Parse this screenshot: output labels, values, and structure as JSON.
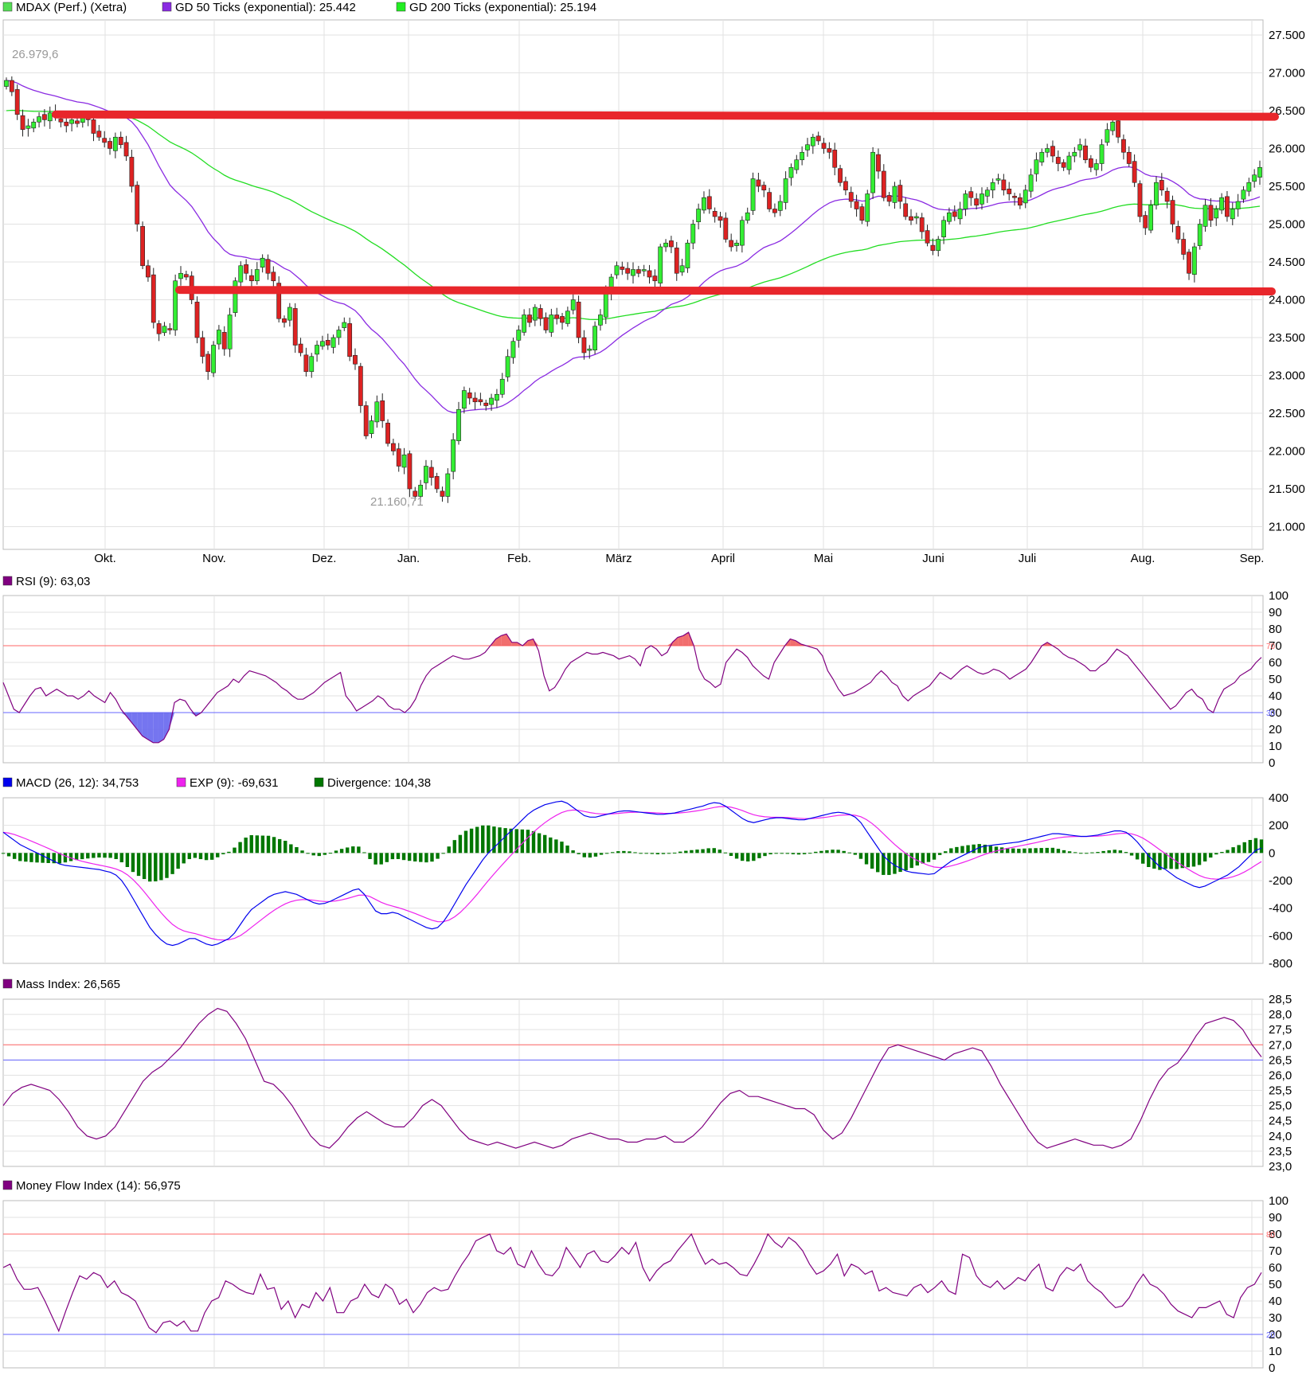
{
  "chart_data": [
    {
      "type": "candlestick",
      "legend": [
        {
          "label": "MDAX (Perf.) (Xetra)",
          "color": "#55dd55"
        },
        {
          "label": "GD 50 Ticks (exponential): 25.442",
          "color": "#8a2be2"
        },
        {
          "label": "GD 200 Ticks (exponential): 25.194",
          "color": "#22ee22"
        }
      ],
      "x_ticks": [
        "Okt.",
        "Nov.",
        "Dez.",
        "Jan.",
        "Feb.",
        "März",
        "April",
        "Mai",
        "Juni",
        "Juli",
        "Aug.",
        "Sep."
      ],
      "y_ticks": [
        "21.000",
        "21.500",
        "22.000",
        "22.500",
        "23.000",
        "23.500",
        "24.000",
        "24.500",
        "25.000",
        "25.500",
        "26.000",
        "26.500",
        "27.000",
        "27.500"
      ],
      "ylim": [
        20700,
        27700
      ],
      "annotations": {
        "high": "26.979,6",
        "low": "21.160,71"
      },
      "closes": [
        26900,
        26750,
        26450,
        26250,
        26300,
        26350,
        26420,
        26380,
        26470,
        26420,
        26350,
        26300,
        26380,
        26330,
        26450,
        26380,
        26200,
        26150,
        26080,
        26000,
        26150,
        26050,
        25900,
        25500,
        25000,
        24450,
        24300,
        23700,
        23550,
        23650,
        23600,
        24250,
        24350,
        24300,
        24000,
        23500,
        23250,
        23050,
        23400,
        23600,
        23350,
        23800,
        24250,
        24450,
        24350,
        24250,
        24400,
        24550,
        24350,
        24250,
        23750,
        23700,
        23900,
        23400,
        23300,
        23050,
        23250,
        23400,
        23450,
        23400,
        23500,
        23600,
        23700,
        23250,
        23150,
        22600,
        22200,
        22400,
        22650,
        22400,
        22100,
        22000,
        21800,
        21950,
        21500,
        21400,
        21550,
        21800,
        21650,
        21500,
        21400,
        21700,
        22150,
        22550,
        22800,
        22700,
        22650,
        22650,
        22600,
        22700,
        22750,
        22950,
        23250,
        23450,
        23600,
        23800,
        23700,
        23900,
        23750,
        23600,
        23800,
        23750,
        23700,
        23850,
        24000,
        23500,
        23300,
        23350,
        23650,
        23800,
        24100,
        24300,
        24450,
        24400,
        24350,
        24400,
        24350,
        24400,
        24300,
        24250,
        24700,
        24750,
        24700,
        24350,
        24450,
        24750,
        25000,
        25200,
        25350,
        25200,
        25100,
        25050,
        24800,
        24700,
        24750,
        25050,
        25150,
        25600,
        25500,
        25450,
        25200,
        25150,
        25300,
        25600,
        25750,
        25850,
        25950,
        26050,
        26150,
        26100,
        26000,
        25950,
        25750,
        25550,
        25450,
        25300,
        25200,
        25050,
        25400,
        25950,
        25700,
        25350,
        25300,
        25500,
        25300,
        25100,
        25050,
        25100,
        24900,
        24750,
        24650,
        24800,
        25050,
        25150,
        25100,
        25200,
        25400,
        25350,
        25250,
        25400,
        25450,
        25550,
        25600,
        25450,
        25400,
        25350,
        25250,
        25450,
        25650,
        25850,
        25950,
        26000,
        25900,
        25800,
        25750,
        25900,
        25950,
        26050,
        25850,
        25750,
        25800,
        26050,
        26250,
        26350,
        26150,
        25950,
        25800,
        25550,
        25100,
        24950,
        25250,
        25550,
        25450,
        25300,
        25000,
        24800,
        24600,
        24350,
        24700,
        25000,
        25250,
        25050,
        25200,
        25350,
        25100,
        25200,
        25300,
        25450,
        25550,
        25650,
        25750
      ]
    },
    {
      "type": "line",
      "title": "RSI (9): 63,03",
      "color": "#800080",
      "ylim": [
        0,
        100
      ],
      "y_ticks": [
        "0",
        "10",
        "20",
        "30",
        "40",
        "50",
        "60",
        "70",
        "80",
        "90",
        "100"
      ],
      "ref_lines": [
        {
          "value": 70,
          "label": "70",
          "color": "#ff6666"
        },
        {
          "value": 30,
          "label": "30",
          "color": "#6666ff"
        }
      ],
      "values": [
        48,
        40,
        32,
        30,
        35,
        40,
        44,
        45,
        40,
        42,
        44,
        42,
        40,
        40,
        38,
        40,
        43,
        40,
        38,
        36,
        42,
        38,
        32,
        28,
        24,
        20,
        16,
        14,
        12,
        12,
        14,
        20,
        36,
        38,
        37,
        32,
        28,
        30,
        34,
        38,
        42,
        44,
        46,
        50,
        48,
        52,
        55,
        54,
        53,
        52,
        50,
        48,
        45,
        43,
        40,
        38,
        38,
        40,
        42,
        45,
        48,
        50,
        52,
        54,
        40,
        36,
        31,
        33,
        35,
        37,
        40,
        38,
        34,
        32,
        32,
        30,
        33,
        38,
        46,
        52,
        56,
        58,
        60,
        62,
        64,
        63,
        62,
        62,
        63,
        64,
        66,
        70,
        74,
        76,
        77,
        72,
        72,
        70,
        73,
        74,
        67,
        52,
        43,
        45,
        50,
        56,
        60,
        62,
        64,
        66,
        65,
        65,
        66,
        65,
        64,
        62,
        63,
        64,
        62,
        58,
        68,
        70,
        68,
        64,
        66,
        72,
        75,
        76,
        78,
        70,
        56,
        50,
        48,
        45,
        47,
        60,
        64,
        68,
        66,
        63,
        58,
        55,
        52,
        50,
        60,
        65,
        70,
        74,
        73,
        71,
        70,
        69,
        68,
        64,
        55,
        50,
        44,
        40,
        41,
        42,
        44,
        46,
        48,
        52,
        55,
        52,
        48,
        46,
        40,
        37,
        40,
        42,
        44,
        46,
        50,
        54,
        52,
        50,
        53,
        56,
        58,
        56,
        54,
        53,
        54,
        56,
        55,
        53,
        50,
        52,
        54,
        56,
        60,
        65,
        70,
        72,
        70,
        68,
        65,
        63,
        62,
        60,
        58,
        55,
        55,
        58,
        60,
        64,
        68,
        66,
        64,
        60,
        56,
        52,
        48,
        44,
        40,
        36,
        32,
        34,
        38,
        42,
        44,
        40,
        38,
        32,
        30,
        38,
        44,
        46,
        48,
        52,
        54,
        56,
        60,
        63
      ]
    },
    {
      "type": "line+bar",
      "legend": [
        {
          "label": "MACD (26, 12): 34,753",
          "color": "#0000ee"
        },
        {
          "label": "EXP (9): -69,631",
          "color": "#ee22ee"
        },
        {
          "label": "Divergence: 104,38",
          "color": "#007700"
        }
      ],
      "ylim": [
        -800,
        400
      ],
      "y_ticks": [
        "-800",
        "-600",
        "-400",
        "-200",
        "0",
        "200",
        "400"
      ],
      "macd": [
        150,
        120,
        90,
        60,
        40,
        20,
        0,
        -20,
        -40,
        -60,
        -80,
        -90,
        -95,
        -100,
        -105,
        -110,
        -115,
        -120,
        -130,
        -140,
        -160,
        -200,
        -260,
        -330,
        -400,
        -470,
        -540,
        -590,
        -630,
        -660,
        -670,
        -660,
        -640,
        -620,
        -620,
        -640,
        -660,
        -670,
        -660,
        -640,
        -620,
        -580,
        -520,
        -460,
        -410,
        -380,
        -350,
        -320,
        -300,
        -290,
        -280,
        -290,
        -300,
        -320,
        -340,
        -360,
        -370,
        -365,
        -350,
        -330,
        -310,
        -290,
        -270,
        -260,
        -300,
        -360,
        -420,
        -440,
        -440,
        -430,
        -440,
        -460,
        -480,
        -500,
        -520,
        -540,
        -550,
        -540,
        -500,
        -440,
        -370,
        -300,
        -230,
        -170,
        -110,
        -50,
        0,
        40,
        80,
        120,
        160,
        200,
        240,
        280,
        310,
        330,
        350,
        360,
        370,
        375,
        360,
        330,
        300,
        270,
        260,
        260,
        270,
        280,
        290,
        300,
        305,
        305,
        300,
        295,
        290,
        285,
        280,
        280,
        285,
        290,
        300,
        310,
        320,
        330,
        340,
        355,
        365,
        360,
        340,
        310,
        280,
        250,
        230,
        220,
        230,
        240,
        250,
        255,
        255,
        250,
        245,
        240,
        240,
        250,
        260,
        270,
        280,
        290,
        295,
        290,
        280,
        260,
        220,
        160,
        100,
        40,
        -20,
        -60,
        -90,
        -110,
        -130,
        -140,
        -145,
        -150,
        -155,
        -150,
        -120,
        -90,
        -60,
        -40,
        -20,
        0,
        20,
        40,
        50,
        55,
        60,
        65,
        70,
        75,
        80,
        90,
        100,
        110,
        120,
        130,
        140,
        140,
        135,
        130,
        125,
        120,
        120,
        125,
        130,
        140,
        150,
        160,
        160,
        150,
        120,
        80,
        30,
        -20,
        -60,
        -100,
        -120,
        -150,
        -180,
        -200,
        -220,
        -240,
        -250,
        -240,
        -220,
        -200,
        -180,
        -160,
        -130,
        -100,
        -60,
        -20,
        20,
        35
      ]
    },
    {
      "type": "line",
      "title": "Mass Index: 26,565",
      "color": "#800080",
      "ylim": [
        23.0,
        28.5
      ],
      "y_ticks": [
        "23,0",
        "23,5",
        "24,0",
        "24,5",
        "25,0",
        "25,5",
        "26,0",
        "26,5",
        "27,0",
        "27,5",
        "28,0",
        "28,5"
      ],
      "ref_lines": [
        {
          "value": 27.0,
          "color": "#ff6666"
        },
        {
          "value": 26.5,
          "color": "#6666ff"
        }
      ],
      "values": [
        25.0,
        25.4,
        25.6,
        25.7,
        25.6,
        25.5,
        25.2,
        24.8,
        24.3,
        24.0,
        23.9,
        24.0,
        24.3,
        24.8,
        25.3,
        25.8,
        26.1,
        26.3,
        26.6,
        26.9,
        27.3,
        27.7,
        28.0,
        28.2,
        28.1,
        27.7,
        27.2,
        26.5,
        25.8,
        25.7,
        25.4,
        25.0,
        24.5,
        24.0,
        23.7,
        23.6,
        23.9,
        24.3,
        24.6,
        24.8,
        24.6,
        24.4,
        24.3,
        24.3,
        24.6,
        25.0,
        25.2,
        25.0,
        24.6,
        24.2,
        23.9,
        23.8,
        23.7,
        23.8,
        23.7,
        23.6,
        23.7,
        23.8,
        23.7,
        23.6,
        23.7,
        23.9,
        24.0,
        24.1,
        24.0,
        23.9,
        23.9,
        23.8,
        23.8,
        23.9,
        23.9,
        24.0,
        23.8,
        23.8,
        24.0,
        24.3,
        24.7,
        25.1,
        25.4,
        25.5,
        25.3,
        25.3,
        25.2,
        25.1,
        25.0,
        24.9,
        24.9,
        24.7,
        24.2,
        23.9,
        24.1,
        24.6,
        25.2,
        25.8,
        26.4,
        26.9,
        27.0,
        26.9,
        26.8,
        26.7,
        26.6,
        26.5,
        26.7,
        26.8,
        26.9,
        26.8,
        26.3,
        25.7,
        25.2,
        24.7,
        24.2,
        23.8,
        23.6,
        23.7,
        23.8,
        23.9,
        23.8,
        23.7,
        23.7,
        23.6,
        23.7,
        23.9,
        24.5,
        25.2,
        25.8,
        26.2,
        26.4,
        26.8,
        27.3,
        27.7,
        27.8,
        27.9,
        27.8,
        27.5,
        27.0,
        26.6
      ],
      "x_ticks": [
        "Okt.",
        "Nov.",
        "Dez.",
        "Jan.",
        "Feb.",
        "März",
        "April",
        "Mai",
        "Juni",
        "Juli",
        "Aug.",
        "Sep."
      ]
    },
    {
      "type": "line",
      "title": "Money Flow Index (14): 56,975",
      "color": "#800080",
      "ylim": [
        0,
        100
      ],
      "y_ticks": [
        "0",
        "10",
        "20",
        "30",
        "40",
        "50",
        "60",
        "70",
        "80",
        "90",
        "100"
      ],
      "ref_lines": [
        {
          "value": 80,
          "label": "80",
          "color": "#ff6666"
        },
        {
          "value": 20,
          "label": "20",
          "color": "#6666ff"
        }
      ],
      "values": [
        60,
        62,
        53,
        47,
        47,
        48,
        40,
        31,
        22,
        34,
        45,
        55,
        53,
        57,
        55,
        48,
        52,
        45,
        43,
        40,
        32,
        24,
        21,
        27,
        28,
        25,
        28,
        22,
        22,
        33,
        40,
        42,
        52,
        50,
        47,
        45,
        44,
        56,
        47,
        48,
        35,
        40,
        30,
        38,
        36,
        45,
        40,
        48,
        33,
        33,
        40,
        42,
        50,
        44,
        42,
        50,
        47,
        38,
        41,
        33,
        38,
        45,
        48,
        46,
        47,
        55,
        62,
        68,
        76,
        78,
        80,
        70,
        68,
        72,
        62,
        60,
        70,
        62,
        56,
        55,
        60,
        72,
        66,
        60,
        68,
        70,
        64,
        63,
        67,
        72,
        68,
        75,
        60,
        52,
        58,
        62,
        64,
        70,
        75,
        80,
        70,
        62,
        65,
        62,
        63,
        60,
        56,
        55,
        62,
        70,
        80,
        75,
        72,
        78,
        75,
        70,
        62,
        56,
        58,
        62,
        68,
        55,
        62,
        60,
        56,
        58,
        46,
        48,
        45,
        44,
        43,
        48,
        50,
        45,
        48,
        52,
        46,
        44,
        68,
        66,
        55,
        50,
        48,
        52,
        47,
        50,
        54,
        52,
        58,
        62,
        48,
        46,
        55,
        60,
        58,
        62,
        52,
        48,
        45,
        40,
        36,
        37,
        42,
        50,
        56,
        50,
        48,
        44,
        38,
        34,
        32,
        30,
        36,
        36,
        38,
        40,
        32,
        30,
        42,
        48,
        50,
        57
      ]
    }
  ]
}
